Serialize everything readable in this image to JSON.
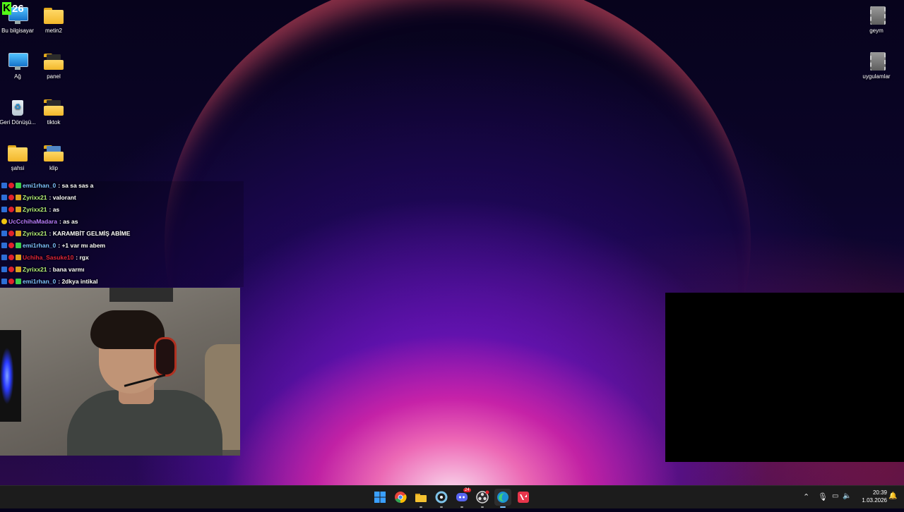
{
  "stream_overlay": {
    "kick_count": "26"
  },
  "desktop_icons": {
    "bu_bilgisayar": "Bu bilgisayar",
    "metin2": "metin2",
    "ag": "Ağ",
    "panel": "panel",
    "geri_donusum": "Geri Dönüşü...",
    "tiktok": "tiktok",
    "sahsi": "şahsi",
    "klip": "klip",
    "geym": "geym",
    "uygulamlar": "uygulamlar"
  },
  "chat": [
    {
      "user": "emi1rhan_0",
      "message": ": sa sa sas a",
      "color": "#7ec3ff"
    },
    {
      "user": "Zyrixx21",
      "message": ": valorant",
      "color": "#b6f27a"
    },
    {
      "user": "Zyrixx21",
      "message": ": as",
      "color": "#b6f27a"
    },
    {
      "user": "UcCchihaMadara",
      "message": ": as as",
      "color": "#b97cff"
    },
    {
      "user": "Zyrixx21",
      "message": ": KARAMBİT GELMİŞ ABİME",
      "color": "#b6f27a"
    },
    {
      "user": "emi1rhan_0",
      "message": ": +1 var mı abem",
      "color": "#7ec3ff"
    },
    {
      "user": "Uchiha_Sasuke10",
      "message": ": rgx",
      "color": "#e0243a"
    },
    {
      "user": "Zyrixx21",
      "message": ": bana varmı",
      "color": "#b6f27a"
    },
    {
      "user": "emi1rhan_0",
      "message": ": 2dkya intikal",
      "color": "#7ec3ff"
    }
  ],
  "taskbar": {
    "apps": [
      "start-icon",
      "chrome-icon",
      "file-explorer-icon",
      "app-icon",
      "discord-icon",
      "obs-icon",
      "edge-icon",
      "valorant-icon"
    ],
    "discord_badge": "24"
  },
  "clock": {
    "time": "20:39",
    "date": "1.03.2026"
  }
}
